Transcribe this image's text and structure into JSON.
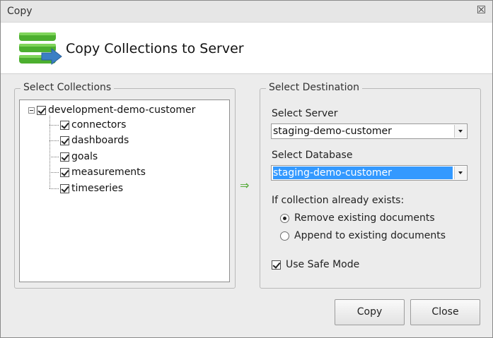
{
  "window": {
    "title": "Copy",
    "close_glyph": "☒"
  },
  "header": {
    "title": "Copy Collections to Server",
    "icon": "stacked-database-arrow-icon"
  },
  "collections": {
    "legend": "Select Collections",
    "root": {
      "label": "development-demo-customer",
      "checked": true,
      "expanded": true
    },
    "items": [
      {
        "label": "connectors",
        "checked": true
      },
      {
        "label": "dashboards",
        "checked": true
      },
      {
        "label": "goals",
        "checked": true
      },
      {
        "label": "measurements",
        "checked": true
      },
      {
        "label": "timeseries",
        "checked": true
      }
    ]
  },
  "arrow_glyph": "⇒",
  "destination": {
    "legend": "Select Destination",
    "server_label": "Select Server",
    "server_value": "staging-demo-customer",
    "database_label": "Select Database",
    "database_value": "staging-demo-customer",
    "exists_label": "If collection already exists:",
    "options": [
      {
        "label": "Remove existing documents",
        "selected": true
      },
      {
        "label": "Append to existing documents",
        "selected": false
      }
    ],
    "safe_mode_label": "Use Safe Mode",
    "safe_mode_checked": true
  },
  "buttons": {
    "copy": "Copy",
    "close": "Close"
  },
  "colors": {
    "selection": "#3399ff",
    "arrow": "#4fa832",
    "logo_green": "#4caf2f",
    "logo_blue": "#3b7fc4"
  }
}
